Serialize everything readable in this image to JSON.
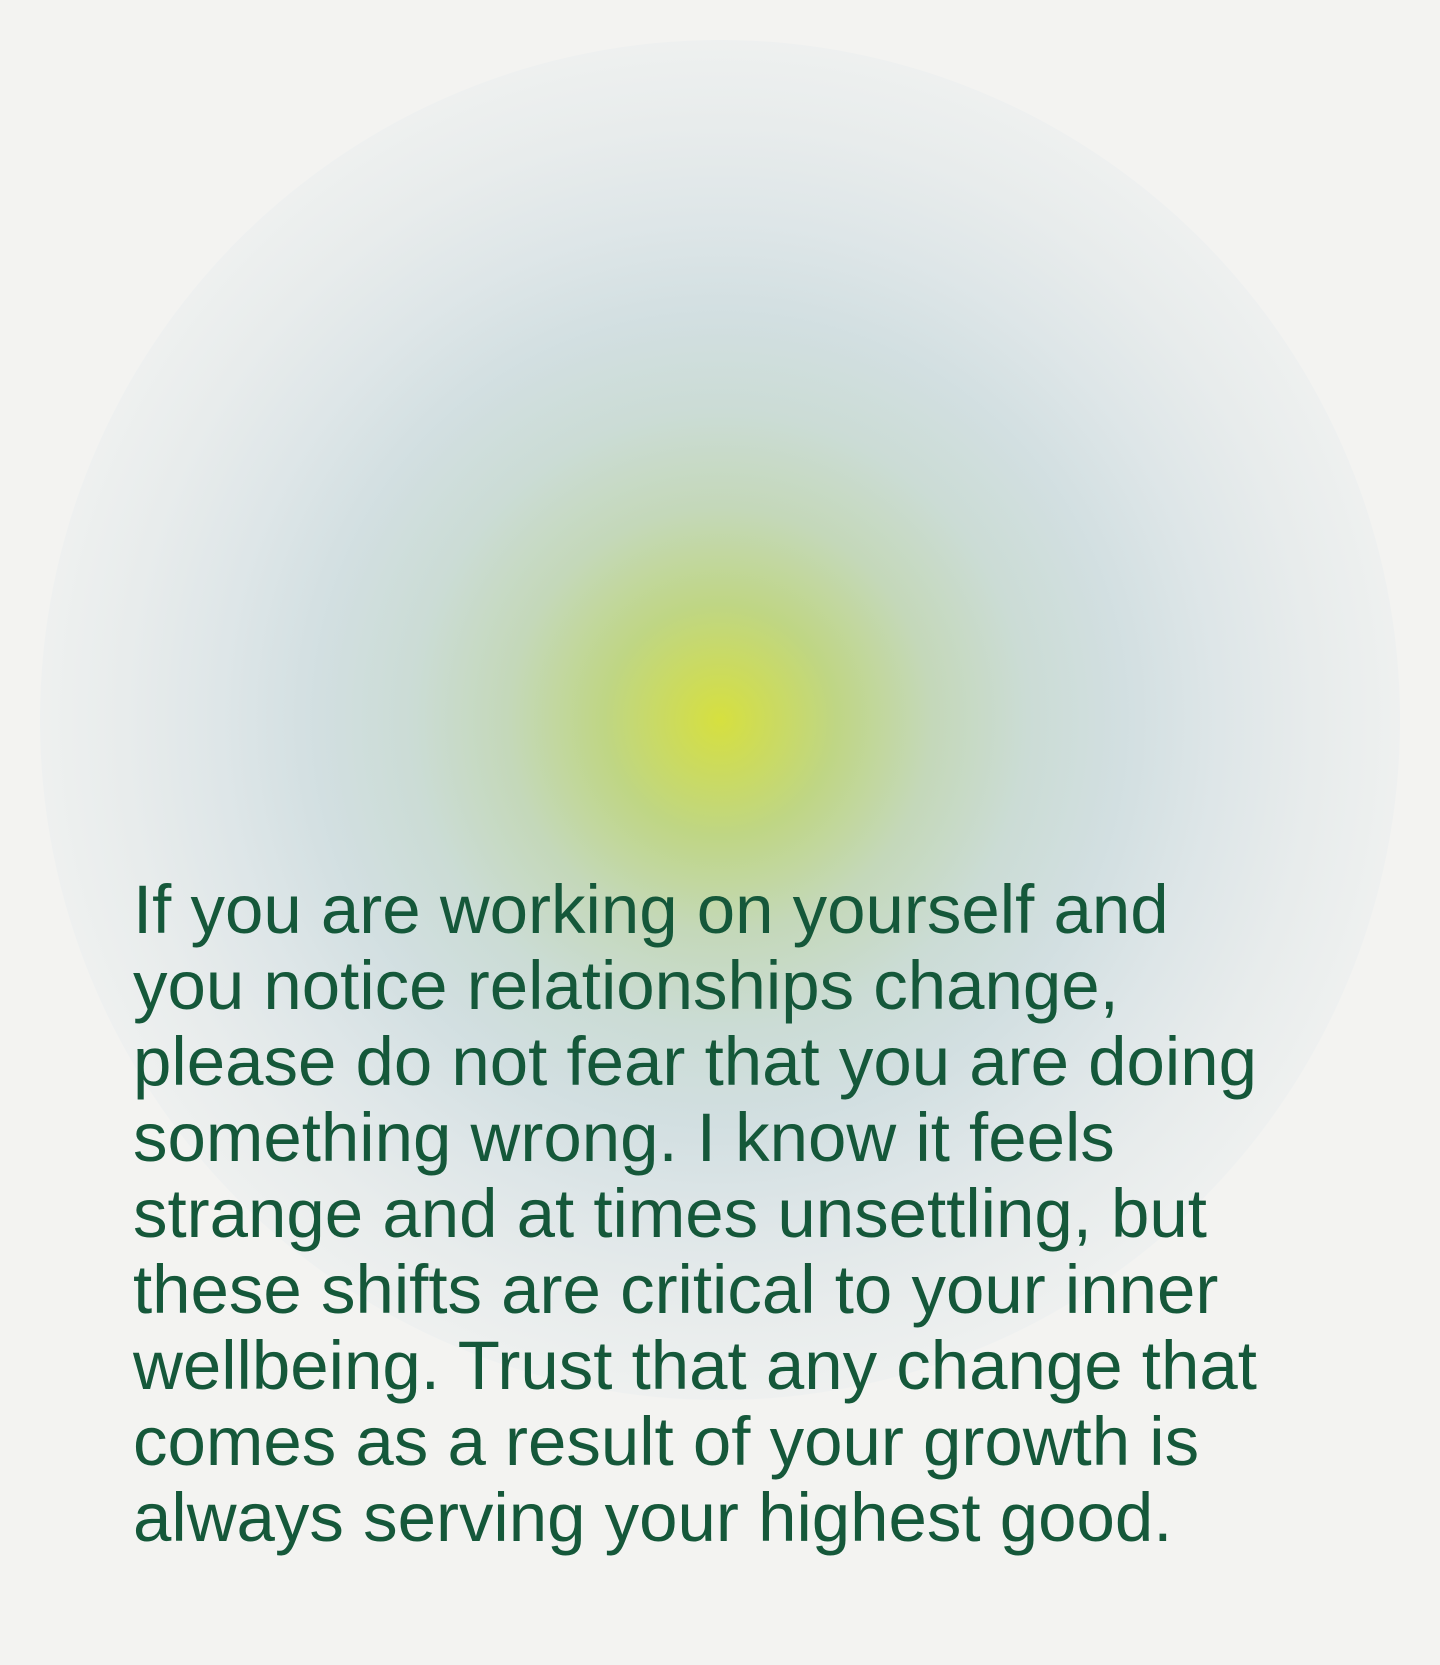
{
  "colors": {
    "background": "#f3f3f1",
    "text": "#15583a",
    "glow_center": "#d6e03f",
    "glow_outer": "#d2dfe1"
  },
  "quote": {
    "lines": [
      "If you are working on yourself and",
      "you notice relationships change,",
      "please do not fear that you are doing",
      "something wrong. I know it feels",
      "strange and at times unsettling, but",
      "these shifts are critical to your inner",
      "wellbeing. Trust that any change that",
      "comes as a result of your growth is",
      "always serving your highest good."
    ]
  }
}
